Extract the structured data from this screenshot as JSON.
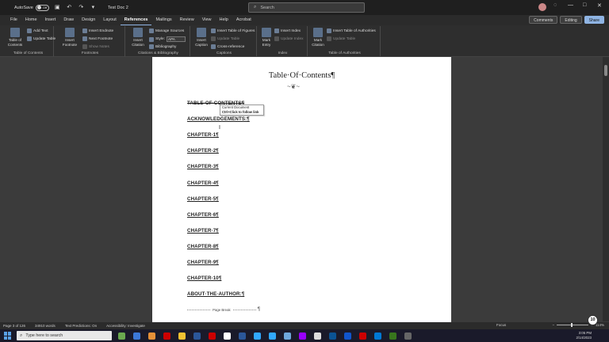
{
  "titlebar": {
    "autosave_label": "AutoSave",
    "autosave_state": "Off",
    "doc_title": "Test Doc 2",
    "search_placeholder": "Search"
  },
  "menu": {
    "tabs": [
      "File",
      "Home",
      "Insert",
      "Draw",
      "Design",
      "Layout",
      "References",
      "Mailings",
      "Review",
      "View",
      "Help",
      "Acrobat"
    ],
    "active": "References",
    "comments_label": "Comments",
    "editing_label": "Editing",
    "share_label": "Share"
  },
  "ribbon": {
    "toc_group": {
      "label": "Table of Contents",
      "toc_button": "Table of Contents",
      "add_text": "Add Text",
      "update_table": "Update Table"
    },
    "footnotes_group": {
      "label": "Footnotes",
      "insert_footnote": "Insert Footnote",
      "insert_endnote": "Insert Endnote",
      "next_footnote": "Next Footnote",
      "show_notes": "Show Notes"
    },
    "citations_group": {
      "label": "Citations & Bibliography",
      "insert_citation": "Insert Citation",
      "manage_sources": "Manage Sources",
      "style_label": "Style:",
      "style_value": "APA",
      "bibliography": "Bibliography"
    },
    "captions_group": {
      "label": "Captions",
      "insert_caption": "Insert Caption",
      "insert_table_of_figures": "Insert Table of Figures",
      "update_table": "Update Table",
      "cross_reference": "Cross-reference"
    },
    "index_group": {
      "label": "Index",
      "mark_entry": "Mark Entry",
      "insert_index": "Insert Index",
      "update_index": "Update Index"
    },
    "authorities_group": {
      "label": "Table of Authorities",
      "mark_citation": "Mark Citation",
      "insert_table_of_authorities": "Insert Table of Authorities",
      "update_table": "Update Table"
    }
  },
  "document": {
    "title": "Table·Of·Contents¶",
    "entries": [
      "TABLE·OF·CONTENTS¶",
      "ACKNOWLEDGEMENTS:¶",
      "CHAPTER·1¶",
      "CHAPTER·2¶",
      "CHAPTER·3¶",
      "CHAPTER·4¶",
      "CHAPTER·5¶",
      "CHAPTER·6¶",
      "CHAPTER·7¶",
      "CHAPTER·8¶",
      "CHAPTER·9¶",
      "CHAPTER·10¶",
      "ABOUT·THE·AUTHOR:¶"
    ],
    "tooltip_line1": "Current Document",
    "tooltip_line2": "Ctrl+Click to follow link",
    "page_break_label": "Page Break",
    "pilcrow": "¶"
  },
  "statusbar": {
    "page": "Page 3 of 126",
    "words": "34910 words",
    "text_predictions": "Text Predictions: On",
    "accessibility": "Accessibility: Investigate",
    "focus": "Focus",
    "zoom": "114%"
  },
  "taskbar": {
    "search_placeholder": "Type here to search",
    "time": "3:05 PM",
    "date": "2/14/2023"
  },
  "badge": "10",
  "colors": {
    "accent": "#8fb4e3",
    "page": "#ffffff",
    "canvas": "#3b3b3b"
  }
}
